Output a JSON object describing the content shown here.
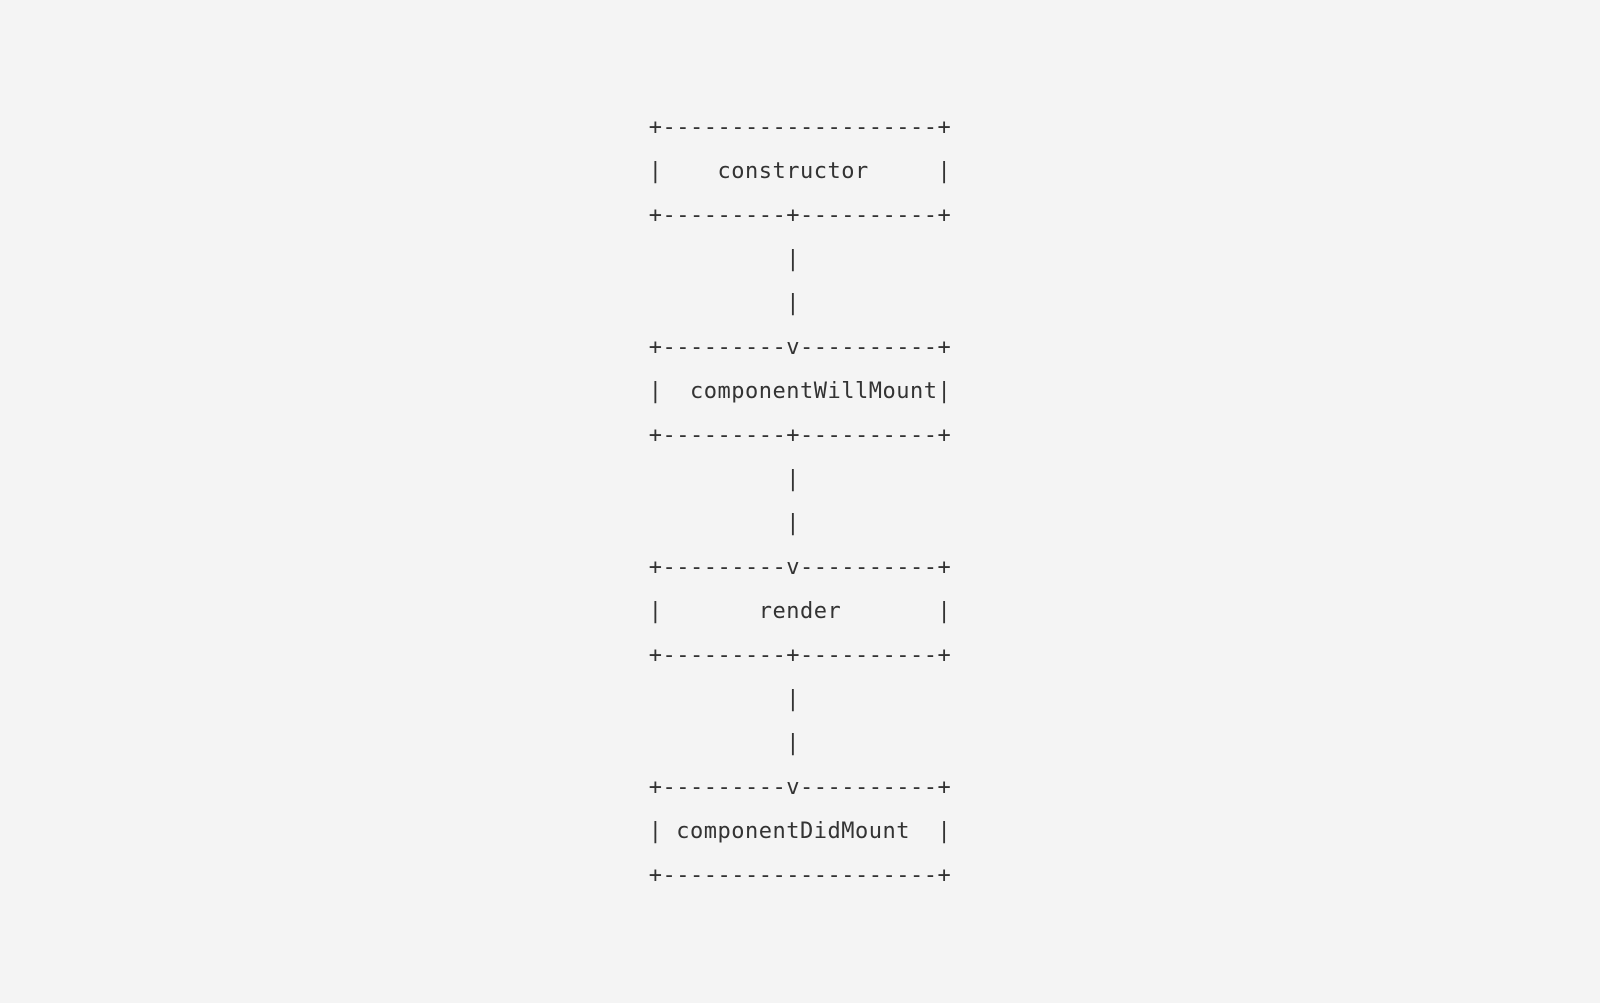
{
  "diagram": {
    "lines": [
      "+--------------------+",
      "|    constructor     |",
      "+---------+----------+",
      "          |           ",
      "          |           ",
      "+---------v----------+",
      "|  componentWillMount|",
      "+---------+----------+",
      "          |           ",
      "          |           ",
      "+---------v----------+",
      "|       render       |",
      "+---------+----------+",
      "          |           ",
      "          |           ",
      "+---------v----------+",
      "| componentDidMount  |",
      "+--------------------+"
    ],
    "boxes": [
      {
        "label": "constructor",
        "order": 1
      },
      {
        "label": "componentWillMount",
        "order": 2
      },
      {
        "label": "render",
        "order": 3
      },
      {
        "label": "componentDidMount",
        "order": 4
      }
    ]
  }
}
